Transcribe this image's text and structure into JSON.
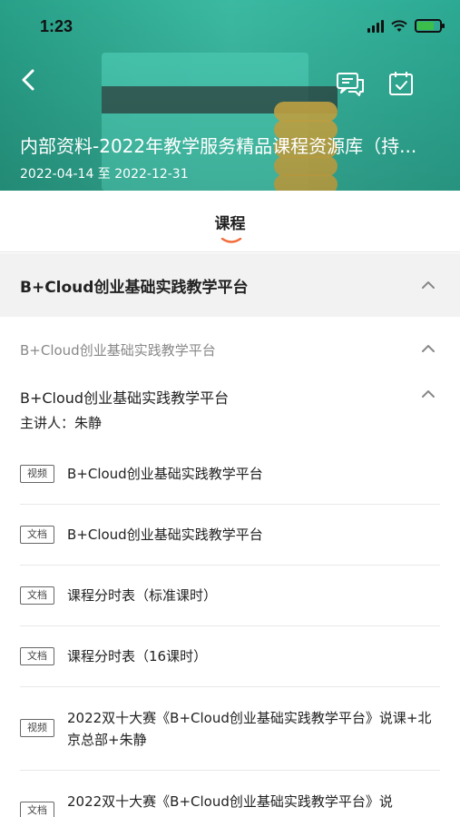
{
  "status_bar": {
    "time": "1:23"
  },
  "header": {
    "title": "内部资料-2022年教学服务精品课程资源库（持...",
    "date_range": "2022-04-14 至 2022-12-31"
  },
  "tabs": [
    {
      "label": "课程",
      "active": true
    }
  ],
  "course_section": {
    "title": "B+Cloud创业基础实践教学平台",
    "chapter_title": "B+Cloud创业基础实践教学平台",
    "lesson": {
      "title": "B+Cloud创业基础实践教学平台",
      "lecturer": "主讲人：朱静"
    },
    "resources": [
      {
        "tag": "视频",
        "title": "B+Cloud创业基础实践教学平台"
      },
      {
        "tag": "文档",
        "title": "B+Cloud创业基础实践教学平台"
      },
      {
        "tag": "文档",
        "title": "课程分时表（标准课时）"
      },
      {
        "tag": "文档",
        "title": "课程分时表（16课时）"
      },
      {
        "tag": "视频",
        "title": "2022双十大赛《B+Cloud创业基础实践教学平台》说课+北京总部+朱静"
      },
      {
        "tag": "文档",
        "title": "2022双十大赛《B+Cloud创业基础实践教学平台》说"
      }
    ]
  },
  "icons": {
    "back": "back-arrow-icon",
    "chat": "chat-icon",
    "calendar": "calendar-check-icon",
    "collapse": "chevron-up-icon"
  },
  "colors": {
    "accent": "#f26b3a",
    "hero": "#2fb39b"
  }
}
